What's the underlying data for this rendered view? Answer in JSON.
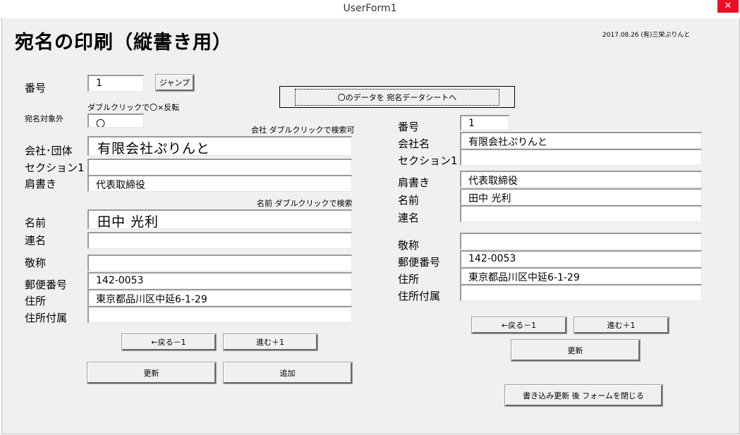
{
  "window": {
    "title": "UserForm1",
    "close_glyph": "✕"
  },
  "header": {
    "title": "宛名の印刷（縦書き用）",
    "credit": "2017.08.26  (有)三栄ぷりんと"
  },
  "left": {
    "number_label": "番号",
    "number_value": "1",
    "jump_button": "ジャンプ",
    "toggle_hint": "ダブルクリックで〇×反転",
    "exclude_label": "宛名対象外",
    "exclude_value": "〇",
    "company_hint": "会社  ダブルクリックで検索可",
    "company_label": "会社･団体",
    "company_value": "有限会社ぷりんと",
    "section_label": "セクション1",
    "section_value": "",
    "title_label": "肩書き",
    "title_value": "代表取締役",
    "name_hint": "名前  ダブルクリックで検索",
    "name_label": "名前",
    "name_value": "田中 光利",
    "joint_label": "連名",
    "joint_value": "",
    "honorific_label": "敬称",
    "honorific_value": "",
    "zip_label": "郵便番号",
    "zip_value": "142-0053",
    "address_label": "住所",
    "address_value": "東京都品川区中延6-1-29",
    "address2_label": "住所付属",
    "address2_value": "",
    "back_button": "←戻る－1",
    "next_button": "進む＋1",
    "update_button": "更新",
    "add_button": "追加"
  },
  "copy_button": "〇のデータを  宛名データシートへ",
  "right": {
    "number_label": "番号",
    "number_value": "1",
    "company_label": "会社名",
    "company_value": "有限会社ぷりんと",
    "section_label": "セクション1",
    "section_value": "",
    "title_label": "肩書き",
    "title_value": "代表取締役",
    "name_label": "名前",
    "name_value": "田中 光利",
    "joint_label": "連名",
    "joint_value": "",
    "honorific_label": "敬称",
    "honorific_value": "",
    "zip_label": "郵便番号",
    "zip_value": "142-0053",
    "address_label": "住所",
    "address_value": "東京都品川区中延6-1-29",
    "address2_label": "住所付属",
    "address2_value": "",
    "back_button": "←戻る－1",
    "next_button": "進む＋1",
    "update_button": "更新",
    "close_button": "書き込み更新  後  フォームを閉じる"
  }
}
